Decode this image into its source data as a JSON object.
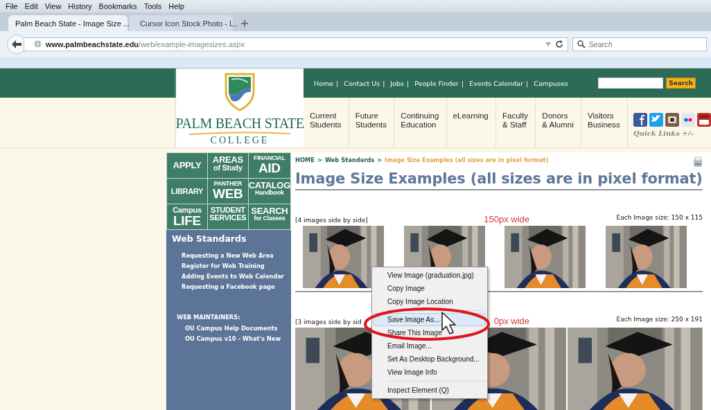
{
  "menu_bar": [
    "File",
    "Edit",
    "View",
    "History",
    "Bookmarks",
    "Tools",
    "Help"
  ],
  "tabs": [
    {
      "title": "Palm Beach State - Image Size ...",
      "selected": true
    },
    {
      "title": "Cursor Icon Stock Photo - L..",
      "selected": false
    }
  ],
  "address": {
    "host": "www.palmbeachstate.edu",
    "path": "/web/example-imagesizes.aspx"
  },
  "search": {
    "placeholder": "Search"
  },
  "site": {
    "logo": {
      "name": "PALM BEACH STATE",
      "sub": "COLLEGE"
    },
    "top_links": [
      {
        "label": "Home",
        "divider": "|"
      },
      {
        "label": "Contact Us",
        "divider": "|"
      },
      {
        "label": "Jobs",
        "divider": "|"
      },
      {
        "label": "People Finder",
        "divider": "|"
      },
      {
        "label": "Events Calendar",
        "divider": "|"
      },
      {
        "label": "Campuses"
      }
    ],
    "search_button": "Search",
    "nav": [
      [
        "Current",
        "Students"
      ],
      [
        "Future",
        "Students"
      ],
      [
        "Continuing",
        "Education"
      ],
      [
        "eLearning"
      ],
      [
        "Faculty",
        "& Staff"
      ],
      [
        "Donors",
        "& Alumni"
      ],
      [
        "Visitors",
        "Business"
      ]
    ],
    "quick_links": "Quick Links +/-"
  },
  "tiles": [
    {
      "lines": [
        {
          "text": "APPLY",
          "kind": "large"
        }
      ]
    },
    {
      "lines": [
        {
          "text": "AREAS",
          "kind": "large"
        },
        {
          "text": "of Study",
          "kind": "medium"
        }
      ]
    },
    {
      "lines": [
        {
          "text": "FINANCIAL",
          "kind": "small"
        },
        {
          "text": "AID",
          "kind": "huge"
        }
      ]
    },
    {
      "lines": [
        {
          "text": "LIBRARY",
          "kind": "medium"
        }
      ]
    },
    {
      "lines": [
        {
          "text": "PANTHER",
          "kind": "small"
        },
        {
          "text": "WEB",
          "kind": "huge"
        }
      ]
    },
    {
      "lines": [
        {
          "text": "CATALOG",
          "kind": "large"
        },
        {
          "text": "Handbook",
          "kind": "small"
        }
      ]
    },
    {
      "lines": [
        {
          "text": "Campus",
          "kind": "medium"
        },
        {
          "text": "LIFE",
          "kind": "huge"
        }
      ]
    },
    {
      "lines": [
        {
          "text": "STUDENT",
          "kind": "medium"
        },
        {
          "text": "SERVICES",
          "kind": "medium"
        }
      ]
    },
    {
      "lines": [
        {
          "text": "SEARCH",
          "kind": "large"
        },
        {
          "text": "for Classes",
          "kind": "small"
        }
      ]
    }
  ],
  "sidebar": {
    "title": "Web Standards",
    "links": [
      "Requesting a New Web Area",
      "Register for Web Training",
      "Adding Events to Web Calendar",
      "Requesting a Facebook page"
    ],
    "section": "WEB MAINTAINERS:",
    "section_links": [
      "OU Campus Help Documents",
      "OU Campus v10 - What's New"
    ]
  },
  "content": {
    "breadcrumb": [
      {
        "text": "HOME",
        "kind": "link"
      },
      {
        "text": ">",
        "kind": "separator"
      },
      {
        "text": "Web Standards",
        "kind": "link"
      },
      {
        "text": ">",
        "kind": "separator"
      },
      {
        "text": "Image Size Examples (all sizes are in pixel format)",
        "kind": "current"
      }
    ],
    "title": "Image Size Examples (all sizes are in pixel format)",
    "sections": [
      {
        "caption": "[4 images side by side]",
        "width_label": "150px wide",
        "size_label": "Each Image size: 150 x 115"
      },
      {
        "caption": "[3 images side by sid",
        "width_label": "0px wide",
        "size_label": "Each Image size: 250 x 191"
      }
    ]
  },
  "context_menu": [
    {
      "kind": "item",
      "label": "View Image (graduation.jpg)",
      "selected": false
    },
    {
      "kind": "item",
      "label": "Copy Image",
      "selected": false
    },
    {
      "kind": "item",
      "label": "Copy Image Location",
      "selected": false
    },
    {
      "kind": "separator"
    },
    {
      "kind": "item",
      "label": "Save Image As...",
      "selected": true
    },
    {
      "kind": "item",
      "label": "Share This Image",
      "selected": false
    },
    {
      "kind": "item",
      "label": "Email Image...",
      "selected": false
    },
    {
      "kind": "item",
      "label": "Set As Desktop Background...",
      "selected": false
    },
    {
      "kind": "item",
      "label": "View Image Info",
      "selected": false
    },
    {
      "kind": "separator"
    },
    {
      "kind": "item",
      "label": "Inspect Element (Q)",
      "selected": false
    }
  ]
}
